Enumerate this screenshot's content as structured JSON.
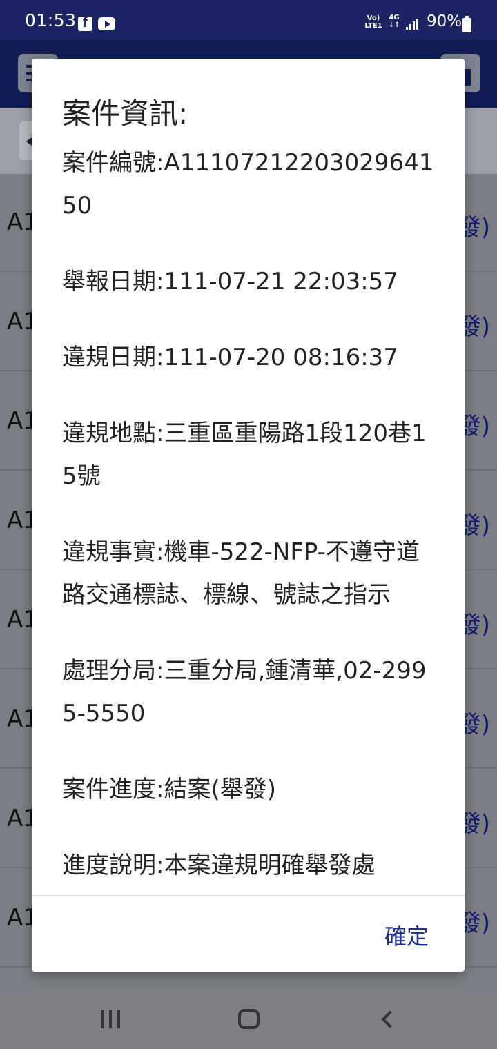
{
  "status_bar": {
    "time": "01:53",
    "volte_line1": "Vo)",
    "volte_line2": "LTE1",
    "network_line1": "4G",
    "network_line2": "↓↑",
    "battery": "90%"
  },
  "background_list": {
    "row_label": "A1",
    "row_status": "發)"
  },
  "dialog": {
    "title": "案件資訊:",
    "fields": [
      "案件編號:A1110721220302964150",
      "舉報日期:111-07-21 22:03:57",
      "違規日期:111-07-20 08:16:37",
      "違規地點:三重區重陽路1段120巷15號",
      "違規事實:機車-522-NFP-不遵守道路交通標誌、標線、號誌之指示",
      "處理分局:三重分局,鍾清華,02-2995-5550",
      "案件進度:結案(舉發)",
      "進度說明:本案違規明確舉發處"
    ],
    "ok_label": "確定"
  },
  "icons": {
    "facebook": "facebook-icon",
    "youtube": "youtube-icon",
    "signal": "signal-strength-icon",
    "battery": "battery-icon",
    "menu": "hamburger-menu-icon",
    "home": "home-icon",
    "back": "chevron-left-icon",
    "nav_recents": "recents-icon",
    "nav_home": "home-circle-icon",
    "nav_back": "back-arrow-icon"
  }
}
